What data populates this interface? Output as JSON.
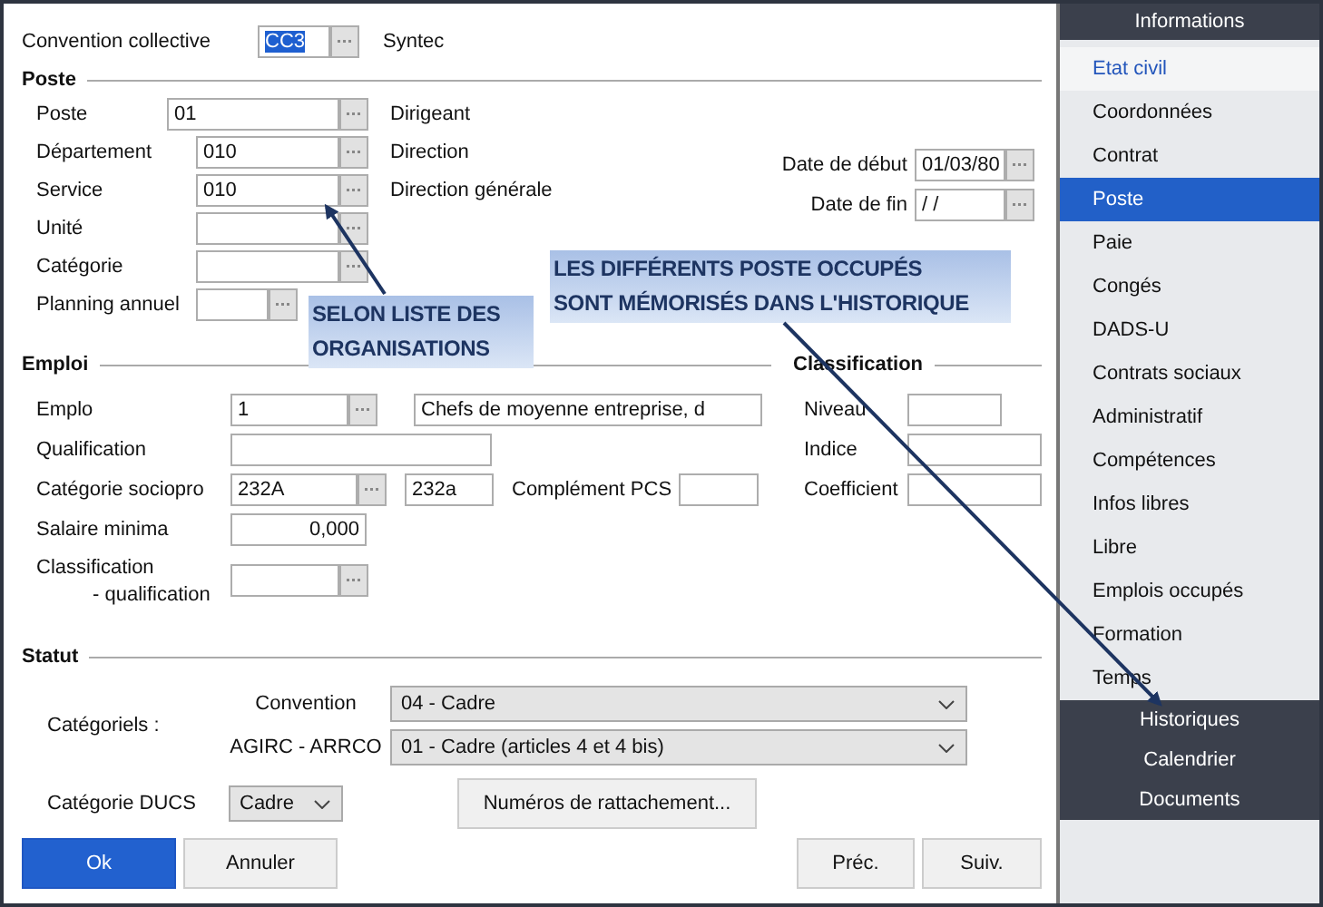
{
  "convention": {
    "label": "Convention collective",
    "code": "CC3",
    "code_selected": true,
    "name": "Syntec"
  },
  "poste": {
    "title": "Poste",
    "fields": [
      {
        "label": "Poste",
        "value": "01",
        "description": "Dirigeant"
      },
      {
        "label": "Département",
        "value": "010",
        "description": "Direction"
      },
      {
        "label": "Service",
        "value": "010",
        "description": "Direction générale"
      },
      {
        "label": "Unité"
      },
      {
        "label": "Catégorie"
      },
      {
        "label": "Planning annuel"
      }
    ],
    "dates": [
      {
        "label": "Date de début",
        "value": "01/03/80"
      },
      {
        "label": "Date de fin",
        "value": " / /"
      }
    ]
  },
  "emploi": {
    "title": "Emploi",
    "emplo": {
      "label": "Emplo",
      "value": "1",
      "description": "Chefs de moyenne entreprise, d"
    },
    "qualification": {
      "label": "Qualification"
    },
    "sociopro": {
      "label": "Catégorie sociopro",
      "value": "232A",
      "code": "232a",
      "complement_label": "Complément PCS"
    },
    "salaire": {
      "label": "Salaire minima",
      "value": "0,000"
    },
    "classification": {
      "label_1": "Classification",
      "label_2": "- qualification"
    }
  },
  "classification": {
    "title": "Classification",
    "fields": [
      {
        "label": "Niveau"
      },
      {
        "label": "Indice"
      },
      {
        "label": "Coefficient"
      }
    ]
  },
  "statut": {
    "title": "Statut",
    "categoriels_label": "Catégoriels :",
    "categoriels": [
      {
        "label": "Convention",
        "value": "04 - Cadre"
      },
      {
        "label": "AGIRC - ARRCO",
        "value": "01 - Cadre (articles 4 et 4 bis)"
      }
    ],
    "ducs": {
      "label": "Catégorie DUCS",
      "value": "Cadre"
    },
    "rattachement_button": "Numéros de rattachement..."
  },
  "footer": {
    "left": [
      {
        "label": "Ok",
        "kind": "primary"
      },
      {
        "label": "Annuler",
        "kind": "default"
      }
    ],
    "right": [
      {
        "label": "Préc.",
        "kind": "default"
      },
      {
        "label": "Suiv.",
        "kind": "default"
      }
    ]
  },
  "sidebar": {
    "title": "Informations",
    "items": [
      {
        "label": "Etat civil",
        "kind": "tab",
        "selected": false,
        "hovered": true
      },
      {
        "label": "Coordonnées",
        "kind": "tab",
        "selected": false,
        "hovered": false
      },
      {
        "label": "Contrat",
        "kind": "tab",
        "selected": false,
        "hovered": false
      },
      {
        "label": "Poste",
        "kind": "tab",
        "selected": true,
        "hovered": false
      },
      {
        "label": "Paie",
        "kind": "tab",
        "selected": false,
        "hovered": false
      },
      {
        "label": "Congés",
        "kind": "tab",
        "selected": false,
        "hovered": false
      },
      {
        "label": "DADS-U",
        "kind": "tab",
        "selected": false,
        "hovered": false
      },
      {
        "label": "Contrats sociaux",
        "kind": "tab",
        "selected": false,
        "hovered": false
      },
      {
        "label": "Administratif",
        "kind": "tab",
        "selected": false,
        "hovered": false
      },
      {
        "label": "Compétences",
        "kind": "tab",
        "selected": false,
        "hovered": false
      },
      {
        "label": "Infos libres",
        "kind": "tab",
        "selected": false,
        "hovered": false
      },
      {
        "label": "Libre",
        "kind": "tab",
        "selected": false,
        "hovered": false
      },
      {
        "label": "Emplois occupés",
        "kind": "tab",
        "selected": false,
        "hovered": false
      },
      {
        "label": "Formation",
        "kind": "tab",
        "selected": false,
        "hovered": false
      },
      {
        "label": "Temps",
        "kind": "tab",
        "selected": false,
        "hovered": false
      },
      {
        "label": "Historiques",
        "kind": "action"
      },
      {
        "label": "Calendrier",
        "kind": "action"
      },
      {
        "label": "Documents",
        "kind": "action"
      }
    ]
  },
  "annotations": [
    {
      "lines": [
        "SELON LISTE DES",
        "ORGANISATIONS"
      ]
    },
    {
      "lines": [
        "LES DIFFÉRENTS POSTE OCCUPÉS",
        "SONT MÉMORISÉS DANS L'HISTORIQUE"
      ]
    }
  ]
}
